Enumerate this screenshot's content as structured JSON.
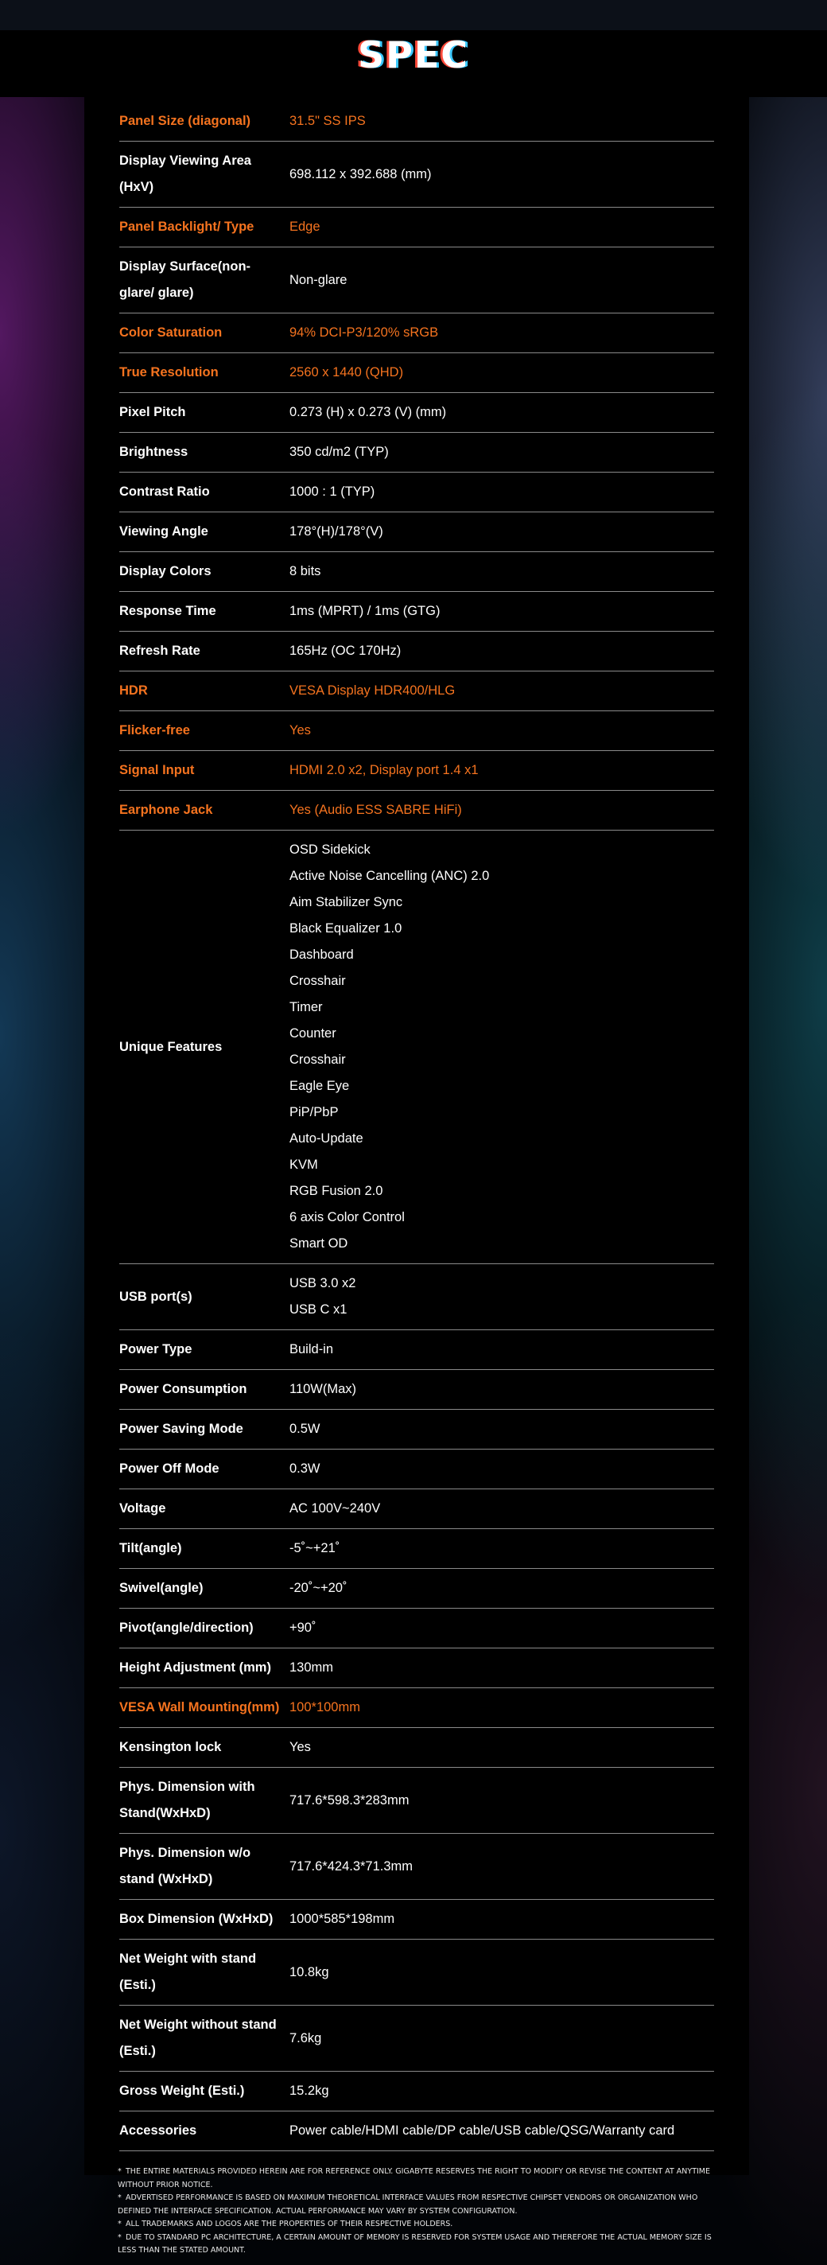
{
  "title": "SPEC",
  "specs": [
    {
      "label": "Panel Size (diagonal)",
      "values": [
        "31.5\" SS IPS"
      ],
      "highlight": true
    },
    {
      "label": "Display Viewing Area (HxV)",
      "values": [
        "698.112 x 392.688 (mm)"
      ],
      "highlight": false
    },
    {
      "label": "Panel Backlight/ Type",
      "values": [
        "Edge"
      ],
      "highlight": true
    },
    {
      "label": "Display Surface(non-glare/ glare)",
      "values": [
        "Non-glare"
      ],
      "highlight": false
    },
    {
      "label": "Color Saturation",
      "values": [
        "94% DCI-P3/120% sRGB"
      ],
      "highlight": true
    },
    {
      "label": "True Resolution",
      "values": [
        "2560 x 1440 (QHD)"
      ],
      "highlight": true
    },
    {
      "label": "Pixel Pitch",
      "values": [
        "0.273 (H) x 0.273 (V) (mm)"
      ],
      "highlight": false
    },
    {
      "label": "Brightness",
      "values": [
        "350 cd/m2 (TYP)"
      ],
      "highlight": false
    },
    {
      "label": "Contrast Ratio",
      "values": [
        "1000 : 1 (TYP)"
      ],
      "highlight": false
    },
    {
      "label": "Viewing Angle",
      "values": [
        "178°(H)/178°(V)"
      ],
      "highlight": false
    },
    {
      "label": "Display Colors",
      "values": [
        "8 bits"
      ],
      "highlight": false
    },
    {
      "label": "Response Time",
      "values": [
        "1ms (MPRT) / 1ms (GTG)"
      ],
      "highlight": false
    },
    {
      "label": "Refresh Rate",
      "values": [
        "165Hz (OC 170Hz)"
      ],
      "highlight": false
    },
    {
      "label": "HDR",
      "values": [
        "VESA Display HDR400/HLG"
      ],
      "highlight": true
    },
    {
      "label": "Flicker-free",
      "values": [
        "Yes"
      ],
      "highlight": true
    },
    {
      "label": "Signal Input",
      "values": [
        "HDMI 2.0 x2, Display port 1.4 x1"
      ],
      "highlight": true
    },
    {
      "label": "Earphone Jack",
      "values": [
        "Yes (Audio ESS SABRE HiFi)"
      ],
      "highlight": true
    },
    {
      "label": "Unique Features",
      "values": [
        "OSD Sidekick",
        "Active Noise Cancelling (ANC) 2.0",
        "Aim Stabilizer Sync",
        "Black Equalizer 1.0",
        "Dashboard",
        "Crosshair",
        "Timer",
        "Counter",
        "Crosshair",
        "Eagle Eye",
        "PiP/PbP",
        "Auto-Update",
        "KVM",
        "RGB Fusion 2.0",
        "6 axis Color Control",
        "Smart OD"
      ],
      "highlight": false
    },
    {
      "label": "USB port(s)",
      "values": [
        "USB 3.0 x2",
        "USB C x1"
      ],
      "highlight": false
    },
    {
      "label": "Power Type",
      "values": [
        "Build-in"
      ],
      "highlight": false
    },
    {
      "label": "Power Consumption",
      "values": [
        "110W(Max)"
      ],
      "highlight": false
    },
    {
      "label": "Power Saving Mode",
      "values": [
        "0.5W"
      ],
      "highlight": false
    },
    {
      "label": "Power Off Mode",
      "values": [
        "0.3W"
      ],
      "highlight": false
    },
    {
      "label": "Voltage",
      "values": [
        "AC 100V~240V"
      ],
      "highlight": false
    },
    {
      "label": "Tilt(angle)",
      "values": [
        "-5˚~+21˚"
      ],
      "highlight": false
    },
    {
      "label": "Swivel(angle)",
      "values": [
        "-20˚~+20˚"
      ],
      "highlight": false
    },
    {
      "label": "Pivot(angle/direction)",
      "values": [
        "+90˚"
      ],
      "highlight": false
    },
    {
      "label": "Height Adjustment (mm)",
      "values": [
        "130mm"
      ],
      "highlight": false
    },
    {
      "label": "VESA Wall Mounting(mm)",
      "values": [
        "100*100mm"
      ],
      "highlight": true
    },
    {
      "label": "Kensington lock",
      "values": [
        "Yes"
      ],
      "highlight": false
    },
    {
      "label": "Phys. Dimension with Stand(WxHxD)",
      "values": [
        "717.6*598.3*283mm"
      ],
      "highlight": false
    },
    {
      "label": "Phys. Dimension w/o stand (WxHxD)",
      "values": [
        "717.6*424.3*71.3mm"
      ],
      "highlight": false
    },
    {
      "label": "Box Dimension (WxHxD)",
      "values": [
        "1000*585*198mm"
      ],
      "highlight": false
    },
    {
      "label": "Net Weight with stand (Esti.)",
      "values": [
        "10.8kg"
      ],
      "highlight": false
    },
    {
      "label": "Net Weight without stand (Esti.)",
      "values": [
        "7.6kg"
      ],
      "highlight": false
    },
    {
      "label": "Gross Weight (Esti.)",
      "values": [
        "15.2kg"
      ],
      "highlight": false
    },
    {
      "label": "Accessories",
      "values": [
        "Power cable/HDMI cable/DP cable/USB cable/QSG/Warranty card"
      ],
      "highlight": false
    }
  ],
  "footnotes": [
    "THE ENTIRE MATERIALS PROVIDED HEREIN ARE FOR REFERENCE ONLY. GIGABYTE RESERVES THE RIGHT TO MODIFY OR REVISE THE CONTENT AT ANYTIME WITHOUT PRIOR NOTICE.",
    "ADVERTISED PERFORMANCE IS BASED ON MAXIMUM THEORETICAL INTERFACE VALUES FROM RESPECTIVE CHIPSET VENDORS OR ORGANIZATION WHO DEFINED THE INTERFACE SPECIFICATION. ACTUAL PERFORMANCE MAY VARY BY SYSTEM CONFIGURATION.",
    "ALL TRADEMARKS AND LOGOS ARE THE PROPERTIES OF THEIR RESPECTIVE HOLDERS.",
    "DUE TO STANDARD PC ARCHITECTURE, A CERTAIN AMOUNT OF MEMORY IS RESERVED FOR SYSTEM USAGE AND THEREFORE THE ACTUAL MEMORY SIZE IS LESS THAN THE STATED AMOUNT."
  ],
  "colors": {
    "highlight": "#f5731f",
    "text": "#ffffff",
    "divider": "#8a8a8a",
    "background": "#000000"
  }
}
